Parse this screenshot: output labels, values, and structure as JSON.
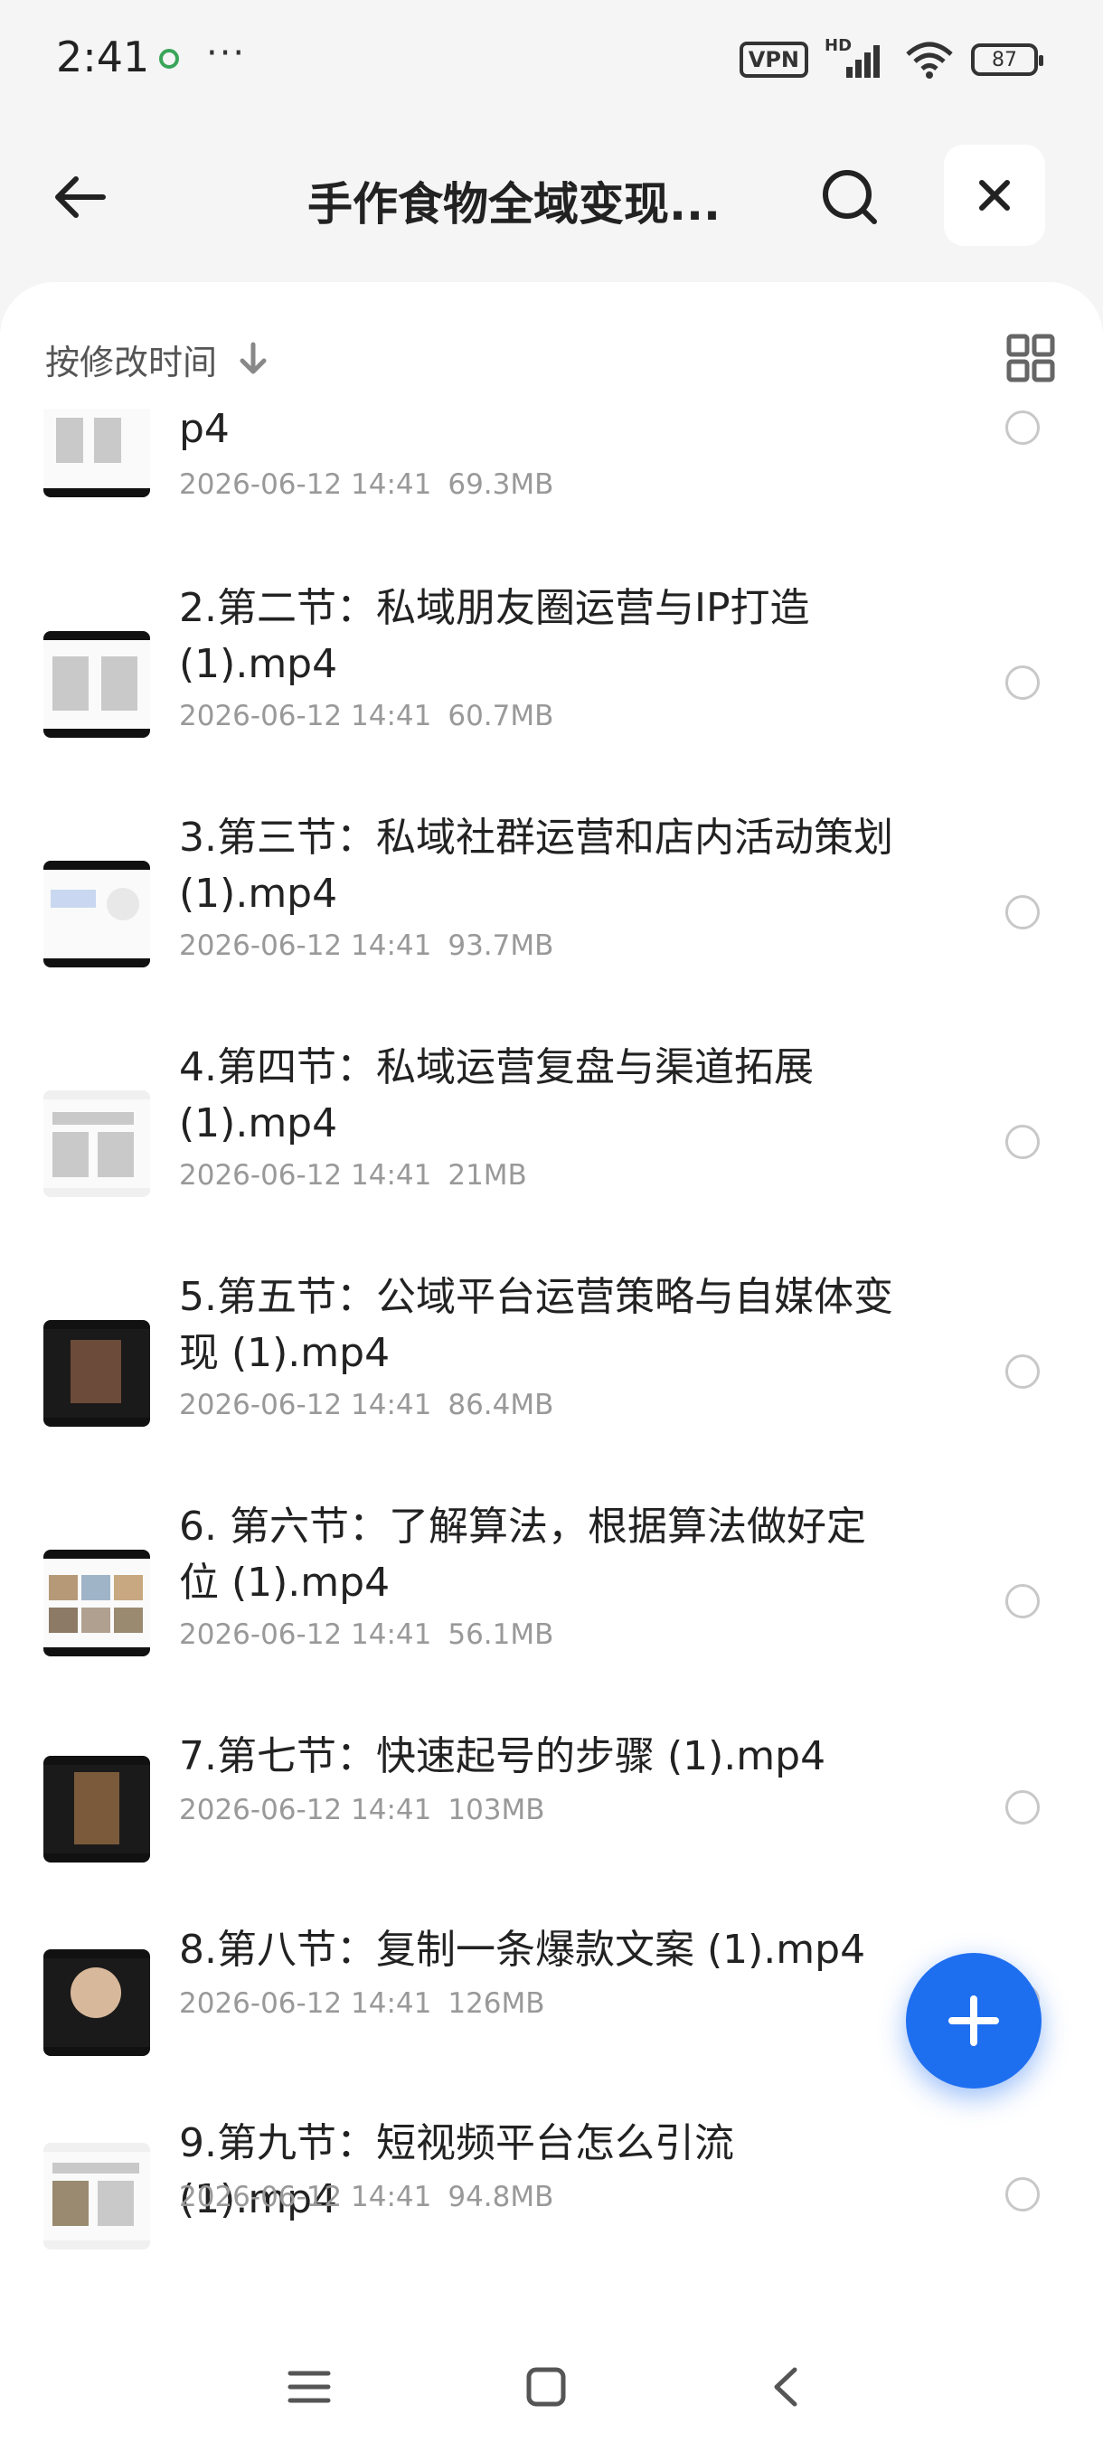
{
  "status_bar": {
    "time": "2:41",
    "more": "···",
    "vpn": "VPN",
    "network": "HD",
    "battery": "87"
  },
  "header": {
    "title": "手作食物全域变现...",
    "icons": {
      "back": "arrow-left-icon",
      "search": "search-icon",
      "close": "close-icon"
    }
  },
  "sort": {
    "label": "按修改时间",
    "direction_icon": "arrow-down-icon",
    "view_toggle_icon": "grid-view-icon"
  },
  "files": [
    {
      "name": "p4",
      "date": "2026-06-12 14:41",
      "size": "69.3MB"
    },
    {
      "name": "2.第二节：私域朋友圈运营与IP打造 (1).mp4",
      "date": "2026-06-12 14:41",
      "size": "60.7MB"
    },
    {
      "name": "3.第三节：私域社群运营和店内活动策划 (1).mp4",
      "date": "2026-06-12 14:41",
      "size": "93.7MB"
    },
    {
      "name": "4.第四节：私域运营复盘与渠道拓展 (1).mp4",
      "date": "2026-06-12 14:41",
      "size": "21MB"
    },
    {
      "name": "5.第五节：公域平台运营策略与自媒体变现 (1).mp4",
      "date": "2026-06-12 14:41",
      "size": "86.4MB"
    },
    {
      "name": "6. 第六节：了解算法，根据算法做好定位 (1).mp4",
      "date": "2026-06-12 14:41",
      "size": "56.1MB"
    },
    {
      "name": "7.第七节：快速起号的步骤 (1).mp4",
      "date": "2026-06-12 14:41",
      "size": "103MB"
    },
    {
      "name": "8.第八节：复制一条爆款文案 (1).mp4",
      "date": "2026-06-12 14:41",
      "size": "126MB"
    },
    {
      "name": "9.第九节：短视频平台怎么引流 (1).mp4",
      "date": "2026-06-12 14:41",
      "size": "94.8MB"
    }
  ],
  "fab": {
    "icon": "plus-icon"
  },
  "navbar": {
    "icons": [
      "menu-icon",
      "home-square-icon",
      "back-chevron-icon"
    ]
  },
  "colors": {
    "accent": "#1e6ef0",
    "background": "#f5f5f5",
    "card": "#ffffff"
  }
}
